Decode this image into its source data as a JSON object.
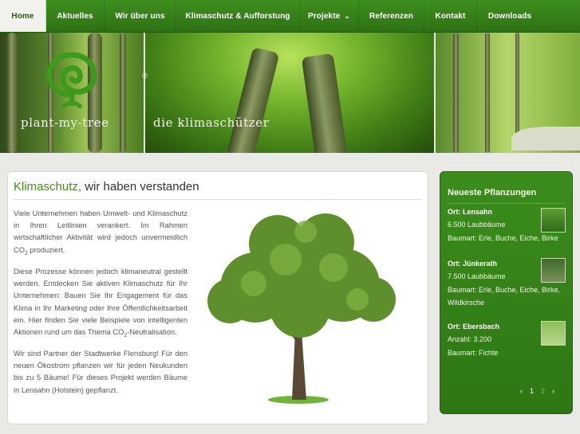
{
  "nav": {
    "items": [
      {
        "label": "Home",
        "active": true
      },
      {
        "label": "Aktuelles"
      },
      {
        "label": "Wir über uns"
      },
      {
        "label": "Klimaschutz & Aufforstung"
      },
      {
        "label": "Projekte",
        "has_dropdown": true
      },
      {
        "label": "Referenzen"
      },
      {
        "label": "Kontakt"
      },
      {
        "label": "Downloads"
      }
    ],
    "dropdown_icon": "chevron-down-icon"
  },
  "banner": {
    "logo_text": "plant-my-tree",
    "registered": "®",
    "tagline": "die klimaschützer"
  },
  "content": {
    "title_main": "Klimaschutz,",
    "title_rest": " wir haben verstanden",
    "p1_a": "Viele Unternehmen haben Umwelt- und Klimaschutz in Ihren Leitlinien verankert. Im Rahmen wirtschaftlicher Aktivität wird jedoch unvermeidlich CO",
    "p1_sub": "2",
    "p1_b": " produziert.",
    "p2_a": "Diese Prozesse können jedoch klimaneutral gestellt werden. Entdecken Sie aktiven Klimaschutz für Ihr Unternehmen: Bauen Sie Ihr Engagement für das Klima in Ihr Marketing oder Ihre Öffentlichkeitsarbeit ein. Hier finden Sie viele Beispiele von intelligenten Aktionen rund um das Thema CO",
    "p2_sub": "2",
    "p2_b": "-Neutralisation.",
    "p3": "Wir sind Partner der Stadtwerke Flensburg! Für den neuen Ökostrom pflanzen wir für jeden Neukunden bis zu 5 Bäume! Für dieses Projekt werden Bäume in Lensahn (Holstein) gepflanzt."
  },
  "sidebar": {
    "title": "Neueste Pflanzungen",
    "entries": [
      {
        "title": "Ort: Lensahn",
        "line1": "6.500 Laubbäume",
        "line2": "Baumart: Erle, Buche, Eiche, Birke",
        "line3": ""
      },
      {
        "title": "Ort: Jünkerath",
        "line1": "7.500 Laubbäume",
        "line2": "Baumart: Erle, Buche, Eiche, Birke,",
        "line3": "Wildkirsche"
      },
      {
        "title": "Ort: Ebersbach",
        "line1": "Anzahl: 3.200",
        "line2": "Baumart: Fichte",
        "line3": ""
      }
    ],
    "pager": {
      "prev": "‹",
      "page1": "1",
      "page2": "2",
      "next": "›"
    }
  },
  "colors": {
    "nav_green": "#3a8a1c",
    "accent_green": "#48891f",
    "sidebar_green": "#358319"
  }
}
